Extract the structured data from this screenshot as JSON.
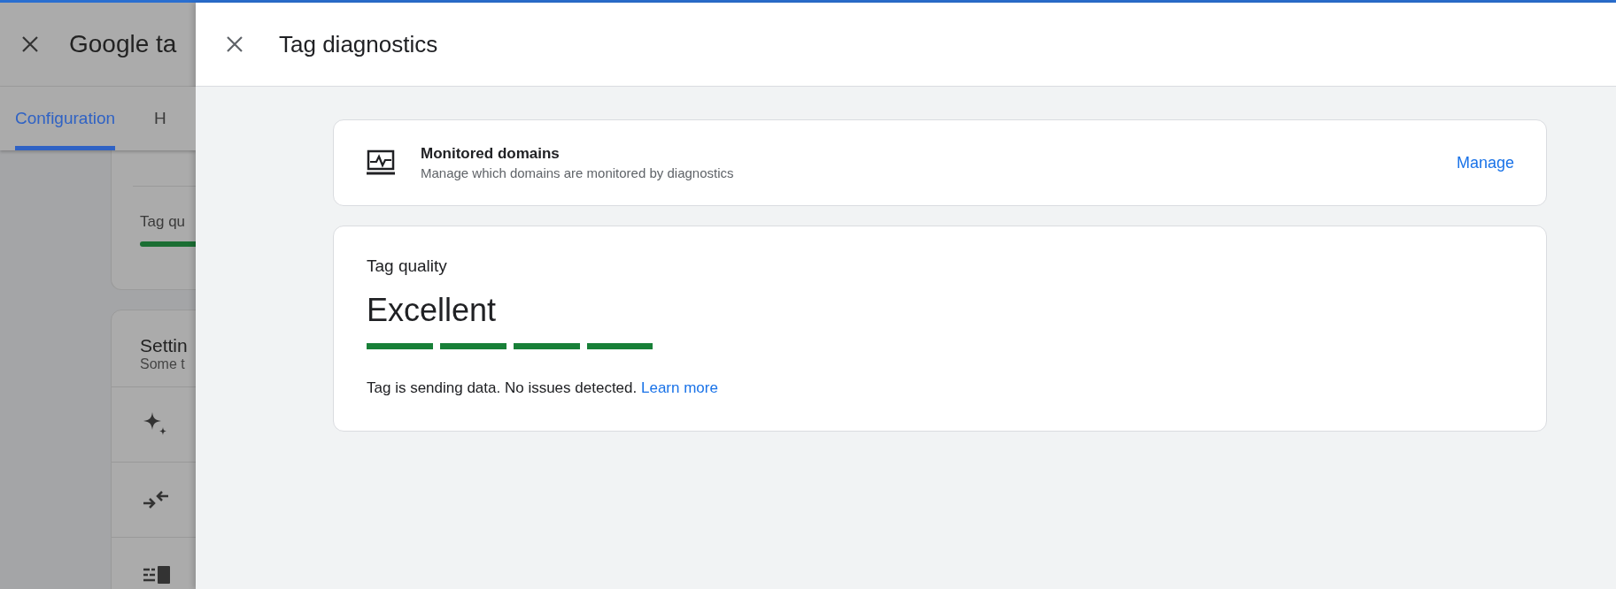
{
  "background_page": {
    "title": "Google ta",
    "tabs": [
      {
        "label": "Configuration",
        "selected": true
      },
      {
        "label": "H",
        "selected": false
      }
    ],
    "quality_card": {
      "label": "Tag qu"
    },
    "settings_card": {
      "title": "Settin",
      "subtitle": "Some t",
      "rows": [
        {
          "kind": "sparkle"
        },
        {
          "kind": "arrows"
        },
        {
          "kind": "list"
        }
      ]
    }
  },
  "drawer": {
    "title": "Tag diagnostics"
  },
  "monitored_domains": {
    "title": "Monitored domains",
    "subtitle": "Manage which domains are monitored by diagnostics",
    "action": "Manage"
  },
  "tag_quality": {
    "label": "Tag quality",
    "rating": "Excellent",
    "level": 1,
    "message": "Tag is sending data. No issues detected.",
    "link": "Learn more"
  }
}
